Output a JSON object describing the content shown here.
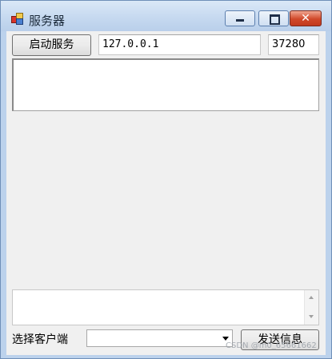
{
  "window": {
    "title": "服务器",
    "controls": {
      "minimize": "minimize",
      "maximize": "maximize",
      "close": "✕"
    }
  },
  "toolbar": {
    "start_button": "启动服务",
    "ip_value": "127.0.0.1",
    "port_value": "37280"
  },
  "log": {
    "text": ""
  },
  "message": {
    "text": ""
  },
  "footer": {
    "client_label": "选择客户端",
    "client_select_value": "",
    "send_button": "发送信息"
  },
  "watermark": "CSDN @m0_65661662",
  "colors": {
    "title_bar": "#c6d9f0",
    "client_bg": "#f0f0f0",
    "close_button": "#d0482a"
  },
  "icons": [
    "app-icon",
    "minimize-icon",
    "maximize-icon",
    "close-icon",
    "scroll-up-icon",
    "scroll-down-icon",
    "dropdown-arrow-icon"
  ]
}
